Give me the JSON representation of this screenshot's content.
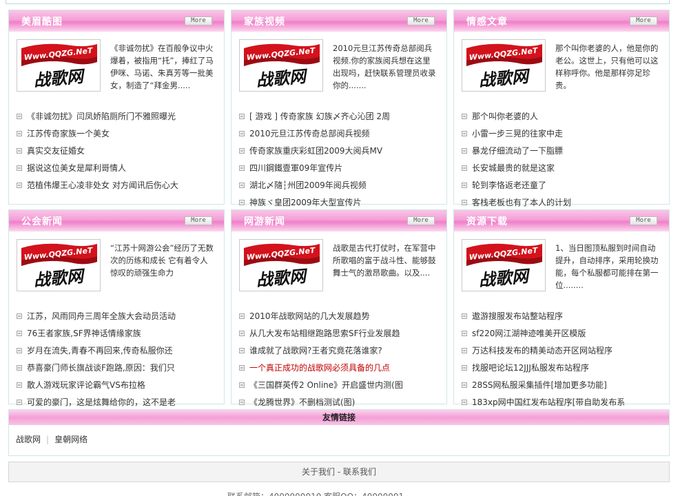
{
  "more_label": "More",
  "logo": {
    "url_text": "Www.QQZG.NeT",
    "brand_text": "战歌网"
  },
  "colors": {
    "header_pink": "#f39fd6",
    "highlight_red": "#c30000",
    "border": "#cfe6e6"
  },
  "panels": [
    {
      "title": "美眉酷图",
      "feature_text": "《非诚勿扰》在百般争议中火爆着，被指用“托”，捧红了马伊咪、马诺、朱真芳等一批美女，制造了“拜金男.....",
      "items": [
        "《非诚勿扰》闫凤娇陷厕所门不雅照曝光",
        "江苏传奇家族一个美女",
        "真实交友征婚女",
        "据说这位美女是犀利哥情人",
        "范植伟爆王心凌非处女 对方闻讯后伤心大"
      ]
    },
    {
      "title": "家族视频",
      "feature_text": "2010元旦江苏传奇总部阅兵视频.你的家族阅兵想在这里出现吗，赶快联系管理员收录你的.......",
      "items": [
        "[ 游戏 ] 传奇家族 幻族〆齐心沁团 2周",
        "2010元旦江苏传奇总部阅兵视频",
        "传奇家族重庆彩虹团2009大阅兵MV",
        "四川鋼鐵壹軍09年宣传片",
        "湖北〆隨┆州团2009年阅兵视频",
        "神族ヾ皇团2009年大型宣传片"
      ]
    },
    {
      "title": "情感文章",
      "feature_text": "那个叫你老婆的人，他是你的老公。这世上，只有他可以这样称呼你。他是那样弥足珍贵。",
      "items": [
        "那个叫你老婆的人",
        "小雷一步三晃的往家中走",
        "暴龙仔细流动了一下脂膘",
        "长安城最贵的就是这家",
        "轮到李恪返老还童了",
        "客栈老板也有了本人的计划"
      ]
    },
    {
      "title": "公会新闻",
      "feature_text": "“江苏十网游公会”经历了无数次的历练和成长 它有着令人惊叹的顽强生命力",
      "items": [
        "江苏，风雨同舟三周年全族大会动员活动",
        "76王者家族,SF界神话情缘家族",
        "岁月在流失,青春不再回来,传奇私服你还",
        "恭喜豪门师长旗战谈F跑路,原因：我们只",
        "散人游戏玩家评论霸气VS布拉格",
        "可爱的豪门，这是炫舞给你的，这不是老"
      ]
    },
    {
      "title": "网游新闻",
      "feature_text": "战歌是古代打仗时，在军营中所歌唱的富于战斗性、能够鼓舞士气的激昂歌曲。以及....",
      "items": [
        "2010年战歌网站的几大发展趋势",
        "从几大发布站相继跑路思索SF行业发展趋",
        "谁成就了战歌网?王者究竟花落谁家?",
        "一个真正成功的战歌网必须具备的几点",
        "《三国群英传2 Online》开启盛世内测(图",
        "《龙腾世界》不删档测试(图)"
      ],
      "highlight_index": 3
    },
    {
      "title": "资源下载",
      "feature_text": "1、当日图顶私服到时间自动提升，自动排序，采用轮换功能，每个私服都可能排在第一位........",
      "items": [
        "遨游搜服发布站整站程序",
        "sf220网江湖神迹唯美开区模版",
        "万达科技发布的精美动态开区网站程序",
        "找服吧论坛12JJJ私服发布站程序",
        "28SS网私服采集插件[增加更多功能]",
        "183xp网中国红发布站程序[带自助发布系"
      ]
    }
  ],
  "friend_links": {
    "title": "友情链接",
    "links": [
      "战歌网",
      "皇朝网络"
    ]
  },
  "footer": {
    "about": "关于我们",
    "separator": "-",
    "contact": "联系我们",
    "bottom_text": "联系邮箱：4000000010              客服QQ：40000001"
  }
}
